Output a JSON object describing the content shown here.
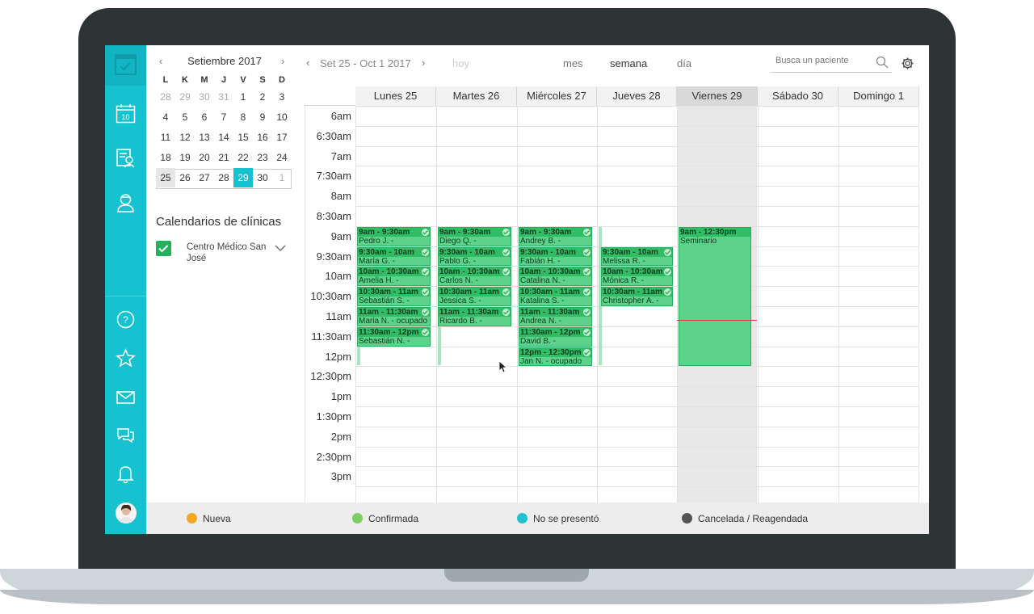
{
  "mini_calendar": {
    "title": "Setiembre 2017",
    "prev": "‹",
    "next": "›",
    "dow": [
      "L",
      "K",
      "M",
      "J",
      "V",
      "S",
      "D"
    ],
    "weeks": [
      [
        "28",
        "29",
        "30",
        "31",
        "1",
        "2",
        "3"
      ],
      [
        "4",
        "5",
        "6",
        "7",
        "8",
        "9",
        "10"
      ],
      [
        "11",
        "12",
        "13",
        "14",
        "15",
        "16",
        "17"
      ],
      [
        "18",
        "19",
        "20",
        "21",
        "22",
        "23",
        "24"
      ],
      [
        "25",
        "26",
        "27",
        "28",
        "29",
        "30",
        "1"
      ]
    ],
    "selected_day": "29"
  },
  "clinics": {
    "title": "Calendarios de clínicas",
    "items": [
      {
        "name": "Centro Médico San José",
        "checked": true
      }
    ]
  },
  "toolbar": {
    "prev": "‹",
    "range": "Set 25 - Oct 1 2017",
    "next": "›",
    "today": "hoy",
    "views": [
      "mes",
      "semana",
      "día"
    ],
    "active_view": "semana",
    "search_placeholder": "Busca un paciente"
  },
  "days": [
    "Lunes 25",
    "Martes 26",
    "Miércoles 27",
    "Jueves 28",
    "Viernes 29",
    "Sábado 30",
    "Domingo 1"
  ],
  "today_index": 4,
  "times": [
    "6am",
    "6:30am",
    "7am",
    "7:30am",
    "8am",
    "8:30am",
    "9am",
    "9:30am",
    "10am",
    "10:30am",
    "11am",
    "11:30am",
    "12pm",
    "12:30pm",
    "1pm",
    "1:30pm",
    "2pm",
    "2:30pm",
    "3pm"
  ],
  "events": [
    {
      "day": 0,
      "slot": 6,
      "len": 1,
      "time": "9am - 9:30am",
      "patient": "Pedro J. -"
    },
    {
      "day": 0,
      "slot": 7,
      "len": 1,
      "time": "9:30am - 10am",
      "patient": "María G. -"
    },
    {
      "day": 0,
      "slot": 8,
      "len": 1,
      "time": "10am - 10:30am",
      "patient": "Amelia H. -"
    },
    {
      "day": 0,
      "slot": 9,
      "len": 1,
      "time": "10:30am - 11am",
      "patient": "Sebastián S. -"
    },
    {
      "day": 0,
      "slot": 10,
      "len": 1,
      "time": "11am - 11:30am",
      "patient": "Maria N. - ocupado"
    },
    {
      "day": 0,
      "slot": 11,
      "len": 1,
      "time": "11:30am - 12pm",
      "patient": "Sebastián N. -"
    },
    {
      "day": 1,
      "slot": 6,
      "len": 1,
      "time": "9am - 9:30am",
      "patient": "Diego Q. -"
    },
    {
      "day": 1,
      "slot": 7,
      "len": 1,
      "time": "9:30am - 10am",
      "patient": "Pablo G. -"
    },
    {
      "day": 1,
      "slot": 8,
      "len": 1,
      "time": "10am - 10:30am",
      "patient": "Carlos N. -"
    },
    {
      "day": 1,
      "slot": 9,
      "len": 1,
      "time": "10:30am - 11am",
      "patient": "Jessica S. -"
    },
    {
      "day": 1,
      "slot": 10,
      "len": 1,
      "time": "11am - 11:30am",
      "patient": "Ricardo B. -"
    },
    {
      "day": 2,
      "slot": 6,
      "len": 1,
      "time": "9am - 9:30am",
      "patient": "Andrey B. -"
    },
    {
      "day": 2,
      "slot": 7,
      "len": 1,
      "time": "9:30am - 10am",
      "patient": "Fabián H. -"
    },
    {
      "day": 2,
      "slot": 8,
      "len": 1,
      "time": "10am - 10:30am",
      "patient": "Catalina N. -"
    },
    {
      "day": 2,
      "slot": 9,
      "len": 1,
      "time": "10:30am - 11am",
      "patient": "Katalina S. -"
    },
    {
      "day": 2,
      "slot": 10,
      "len": 1,
      "time": "11am - 11:30am",
      "patient": "Andrea N. -"
    },
    {
      "day": 2,
      "slot": 11,
      "len": 1,
      "time": "11:30am - 12pm",
      "patient": "David B. -"
    },
    {
      "day": 2,
      "slot": 12,
      "len": 1,
      "time": "12pm - 12:30pm",
      "patient": "Jan N. - ocupado"
    },
    {
      "day": 3,
      "slot": 7,
      "len": 1,
      "time": "9:30am - 10am",
      "patient": "Melissa R. -"
    },
    {
      "day": 3,
      "slot": 8,
      "len": 1,
      "time": "10am - 10:30am",
      "patient": "Mónica R. -"
    },
    {
      "day": 3,
      "slot": 9,
      "len": 1,
      "time": "10:30am - 11am",
      "patient": "Christopher A. -"
    },
    {
      "day": 4,
      "slot": 6,
      "len": 7,
      "time": "9am - 12:30pm",
      "patient": "Seminario",
      "wide": true
    }
  ],
  "legend": [
    {
      "label": "Nueva",
      "color": "#f5a623"
    },
    {
      "label": "Confirmada",
      "color": "#7ccf5e"
    },
    {
      "label": "No se presentó",
      "color": "#22c0d1"
    },
    {
      "label": "Cancelada / Reagendada",
      "color": "#555555"
    }
  ]
}
